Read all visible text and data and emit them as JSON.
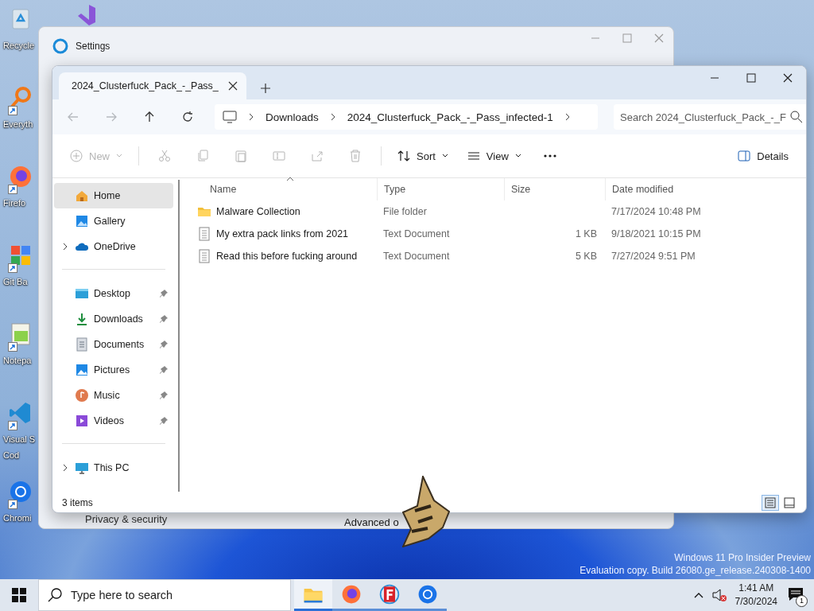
{
  "desktop": {
    "icons": [
      {
        "kind": "bin",
        "lines": [
          "Recycle"
        ],
        "shortcut": false
      },
      {
        "kind": "everything",
        "lines": [
          "Everyth"
        ],
        "shortcut": true
      },
      {
        "kind": "firefox",
        "lines": [
          "Firefo"
        ],
        "shortcut": true
      },
      {
        "kind": "git",
        "lines": [
          "Git Ba"
        ],
        "shortcut": true
      },
      {
        "kind": "notepad",
        "lines": [
          "Notepa"
        ],
        "shortcut": true
      },
      {
        "kind": "vscode",
        "lines": [
          "Visual S",
          "Cod"
        ],
        "shortcut": true
      },
      {
        "kind": "chrome",
        "lines": [
          "Chromi"
        ],
        "shortcut": true
      }
    ],
    "watermark_lines": [
      "Windows 11 Pro Insider Preview",
      "Evaluation copy. Build 26080.ge_release.240308-1400"
    ]
  },
  "settings_window": {
    "title": "Settings",
    "nav_item": "Privacy & security",
    "link": "Advanced o"
  },
  "explorer": {
    "tab": {
      "title": "2024_Clusterfuck_Pack_-_Pass_"
    },
    "nav": [
      {
        "kind": "back",
        "disabled": true
      },
      {
        "kind": "forward",
        "disabled": true
      },
      {
        "kind": "up",
        "disabled": false
      },
      {
        "kind": "refresh",
        "disabled": false
      }
    ],
    "breadcrumbs": [
      "Downloads",
      "2024_Clusterfuck_Pack_-_Pass_infected-1"
    ],
    "search": {
      "placeholder": "Search 2024_Clusterfuck_Pack_-_F"
    },
    "commands": [
      {
        "kind": "new",
        "label": "New",
        "disabled": true
      },
      {
        "kind": "cut",
        "disabled": true
      },
      {
        "kind": "copy",
        "disabled": true
      },
      {
        "kind": "paste",
        "disabled": true
      },
      {
        "kind": "rename",
        "disabled": true
      },
      {
        "kind": "share",
        "disabled": true
      },
      {
        "kind": "delete",
        "disabled": true
      },
      {
        "kind": "sort",
        "label": "Sort",
        "disabled": false
      },
      {
        "kind": "view",
        "label": "View",
        "disabled": false
      },
      {
        "kind": "more",
        "disabled": false
      }
    ],
    "details_button": "Details",
    "sidebar": {
      "sections": [
        {
          "items": [
            {
              "kind": "home",
              "label": "Home",
              "selected": true,
              "expandable": false,
              "pinned": false
            },
            {
              "kind": "gallery",
              "label": "Gallery",
              "selected": false,
              "expandable": false,
              "pinned": false
            },
            {
              "kind": "cloud",
              "label": "OneDrive",
              "selected": false,
              "expandable": true,
              "pinned": false
            }
          ]
        },
        {
          "items": [
            {
              "kind": "desktop",
              "label": "Desktop",
              "selected": false,
              "expandable": false,
              "pinned": true
            },
            {
              "kind": "download",
              "label": "Downloads",
              "selected": false,
              "expandable": false,
              "pinned": true
            },
            {
              "kind": "document",
              "label": "Documents",
              "selected": false,
              "expandable": false,
              "pinned": true
            },
            {
              "kind": "pictures",
              "label": "Pictures",
              "selected": false,
              "expandable": false,
              "pinned": true
            },
            {
              "kind": "music",
              "label": "Music",
              "selected": false,
              "expandable": false,
              "pinned": true
            },
            {
              "kind": "video",
              "label": "Videos",
              "selected": false,
              "expandable": false,
              "pinned": true
            }
          ]
        },
        {
          "items": [
            {
              "kind": "pc",
              "label": "This PC",
              "selected": false,
              "expandable": true,
              "pinned": false
            }
          ]
        }
      ]
    },
    "columns": [
      {
        "label": "Name",
        "sorted": true
      },
      {
        "label": "Type",
        "sorted": false
      },
      {
        "label": "Size",
        "sorted": false
      },
      {
        "label": "Date modified",
        "sorted": false
      }
    ],
    "rows": [
      {
        "kind": "folder",
        "name": "Malware Collection",
        "type": "File folder",
        "date": "7/17/2024 10:48 PM"
      },
      {
        "kind": "text",
        "name": "My extra pack links from 2021",
        "type": "Text Document",
        "size": "1 KB",
        "date": "9/18/2021 10:15 PM"
      },
      {
        "kind": "text",
        "name": "Read this before fucking around",
        "type": "Text Document",
        "size": "5 KB",
        "date": "7/27/2024 9:51 PM"
      }
    ],
    "status": "3 items",
    "view_modes": [
      {
        "kind": "details",
        "selected": true
      },
      {
        "kind": "tiles",
        "selected": false
      }
    ]
  },
  "taskbar": {
    "search_placeholder": "Type here to search",
    "apps": [
      {
        "kind": "explorer",
        "active": true
      },
      {
        "kind": "firefox",
        "active": false
      },
      {
        "kind": "fapp",
        "active": false
      },
      {
        "kind": "chrome",
        "active": false
      }
    ],
    "time": "1:41 AM",
    "date": "7/30/2024",
    "notification_count": "1"
  }
}
